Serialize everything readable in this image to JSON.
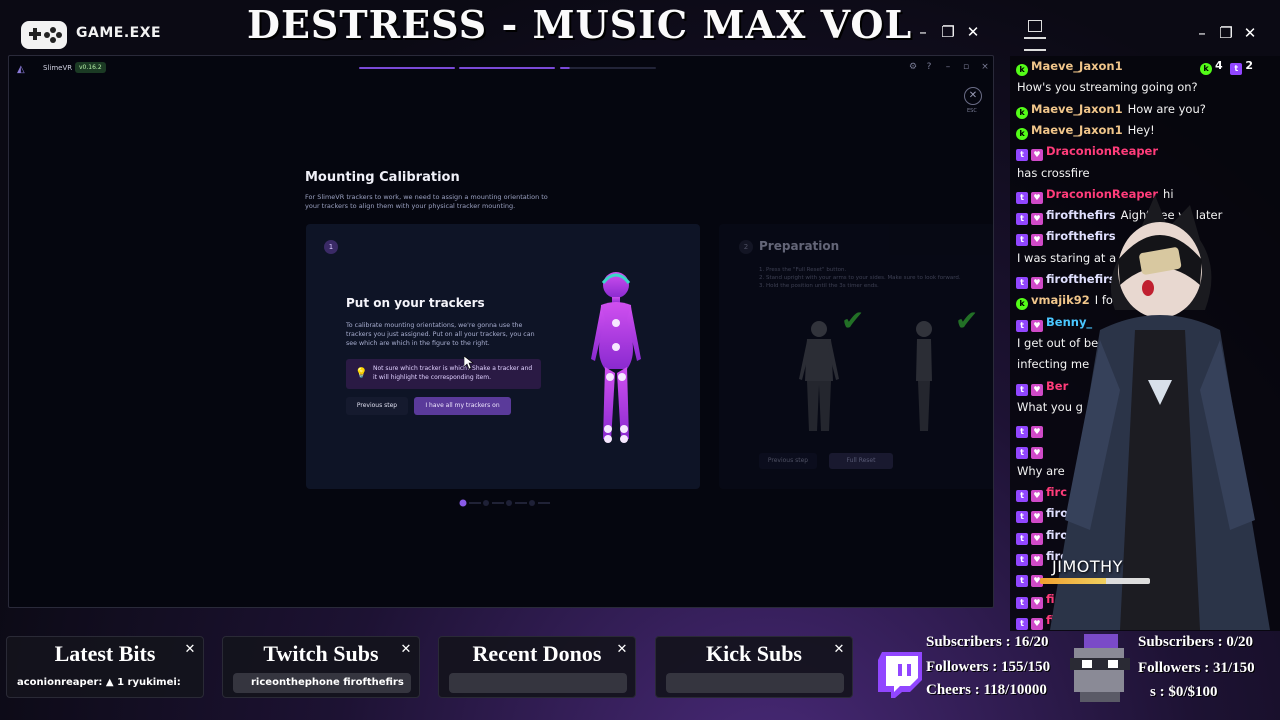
{
  "header": {
    "game_label": "GAME.EXE",
    "stream_title": "DESTRESS - MUSIC MAX VOL"
  },
  "app": {
    "name": "SlimeVR",
    "version": "v0.16.2",
    "esc_label": "ESC",
    "page": {
      "heading": "Mounting Calibration",
      "description": "For SlimeVR trackers to work, we need to assign a mounting orientation to your trackers to align them with your physical tracker mounting."
    },
    "step1": {
      "number": "1",
      "title": "Put on your trackers",
      "text": "To calibrate mounting orientations, we're gonna use the trackers you just assigned. Put on all your trackers, you can see which are which in the figure to the right.",
      "hint": "Not sure which tracker is which? Shake a tracker and it will highlight the corresponding item.",
      "previous_label": "Previous step",
      "confirm_label": "I have all my trackers on"
    },
    "step2": {
      "number": "2",
      "title": "Preparation",
      "text_lines": [
        "1. Press the \"Full Reset\" button.",
        "2. Stand upright with your arms to your sides. Make sure to look forward.",
        "3. Hold the position until the 3s timer ends."
      ],
      "previous_label": "Previous step",
      "reset_label": "Full Reset"
    }
  },
  "chat": {
    "kick_count": "4",
    "twitch_count": "2",
    "messages": [
      {
        "platform": "kick",
        "name": "Maeve_Jaxon1",
        "text": ""
      },
      {
        "platform": "none",
        "name": "",
        "text": "How's you streaming going on?"
      },
      {
        "platform": "kick",
        "name": "Maeve_Jaxon1",
        "text": "How are you?"
      },
      {
        "platform": "kick",
        "name": "Maeve_Jaxon1",
        "text": "Hey!"
      },
      {
        "platform": "twitch",
        "name": "DraconionReaper",
        "text": ""
      },
      {
        "platform": "none",
        "name": "",
        "text": "has crossfire"
      },
      {
        "platform": "twitch",
        "name": "DraconionReaper",
        "text": "hi"
      },
      {
        "platform": "twitch",
        "name": "firofthefirs",
        "text": "Aight see ya later"
      },
      {
        "platform": "twitch",
        "name": "firofthefirs",
        "text": ""
      },
      {
        "platform": "none",
        "name": "",
        "text": "I was staring at a blank scr"
      },
      {
        "platform": "twitch",
        "name": "firofthefirs",
        "text": "I must h"
      },
      {
        "platform": "kick",
        "name": "vmajik92",
        "text": "I followed"
      },
      {
        "platform": "twitch",
        "name": "Benny_",
        "text": ""
      },
      {
        "platform": "none",
        "name": "",
        "text": "I get out of bed and"
      },
      {
        "platform": "none",
        "name": "",
        "text": "infecting me"
      },
      {
        "platform": "twitch",
        "name": "Ber",
        "text": ""
      },
      {
        "platform": "none",
        "name": "",
        "text": "What you g"
      },
      {
        "platform": "twitch",
        "name": "",
        "text": ""
      },
      {
        "platform": "twitch",
        "name": "",
        "text": ""
      },
      {
        "platform": "none",
        "name": "",
        "text": "Why are"
      },
      {
        "platform": "twitch",
        "name": "firc",
        "text": ""
      },
      {
        "platform": "twitch",
        "name": "firofl",
        "text": ""
      },
      {
        "platform": "twitch",
        "name": "firoft",
        "text": ""
      },
      {
        "platform": "twitch",
        "name": "firoft",
        "text": ""
      },
      {
        "platform": "twitch",
        "name": "",
        "text": ""
      },
      {
        "platform": "twitch",
        "name": "fi",
        "text": ""
      },
      {
        "platform": "twitch",
        "name": "fi",
        "text": ""
      },
      {
        "platform": "twitch",
        "name": "",
        "text": ""
      }
    ],
    "avatar_name": "JIMOTHY"
  },
  "widgets": {
    "latest_bits": {
      "title": "Latest Bits",
      "content": "aconionreaper:  ▲ 1   ryukimei:"
    },
    "twitch_subs": {
      "title": "Twitch Subs",
      "content": "riceonthephone      firofthefirs"
    },
    "recent_donos": {
      "title": "Recent Donos",
      "content": ""
    },
    "kick_subs": {
      "title": "Kick Subs",
      "content": ""
    }
  },
  "stats": {
    "twitch": {
      "subscribers": "Subscribers : 16/20",
      "followers": "Followers : 155/150",
      "cheers": "Cheers : 118/10000"
    },
    "kick": {
      "subscribers": "Subscribers : 0/20",
      "followers": "Followers : 31/150",
      "donations": "s : $0/$100"
    }
  },
  "colors": {
    "accent": "#7a4ad8",
    "twitch": "#9146ff",
    "kick": "#53fc18"
  }
}
